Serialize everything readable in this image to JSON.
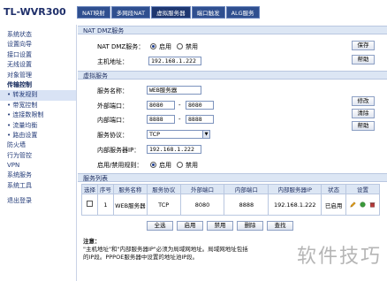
{
  "brand": "TL-WVR300",
  "tabs": [
    {
      "label": "NAT映射",
      "active": false
    },
    {
      "label": "多网段NAT",
      "active": false
    },
    {
      "label": "虚拟服务器",
      "active": true
    },
    {
      "label": "端口触发",
      "active": false
    },
    {
      "label": "ALG服务",
      "active": false
    }
  ],
  "sidebar": {
    "items": [
      {
        "label": "系统状态"
      },
      {
        "label": "设置向导"
      },
      {
        "label": "接口设置"
      },
      {
        "label": "无线设置"
      },
      {
        "label": "对象管理"
      },
      {
        "label": "传输控制"
      },
      {
        "label": "转发规则"
      },
      {
        "label": "带宽控制"
      },
      {
        "label": "连接数限制"
      },
      {
        "label": "流量均衡"
      },
      {
        "label": "路由设置"
      },
      {
        "label": "防火墙"
      },
      {
        "label": "行为管控"
      },
      {
        "label": "VPN"
      },
      {
        "label": "系统服务"
      },
      {
        "label": "系统工具"
      },
      {
        "label": "退出登录"
      }
    ]
  },
  "dmz": {
    "section_title": "NAT DMZ服务",
    "service_label": "NAT DMZ服务：",
    "enable_label": "启用",
    "disable_label": "禁用",
    "host_label": "主机地址：",
    "host_value": "192.168.1.222",
    "save_button": "保存",
    "help_button": "帮助"
  },
  "virtual": {
    "section_title": "虚拟服务",
    "name_label": "服务名称：",
    "name_value": "WEB服务器",
    "ext_port_label": "外部端口：",
    "ext_port_from": "8080",
    "ext_port_to": "8080",
    "int_port_label": "内部端口：",
    "int_port_from": "8888",
    "int_port_to": "8888",
    "protocol_label": "服务协议：",
    "protocol_value": "TCP",
    "server_ip_label": "内部服务器IP：",
    "server_ip_value": "192.168.1.222",
    "rule_label": "启用/禁用规则：",
    "enable_label": "启用",
    "disable_label": "禁用",
    "modify_button": "修改",
    "clear_button": "清除",
    "help_button": "帮助",
    "dash": "-"
  },
  "list": {
    "section_title": "服务列表",
    "headers": [
      "选择",
      "序号",
      "服务名称",
      "服务协议",
      "外部端口",
      "内部端口",
      "内部服务器IP",
      "状态",
      "设置"
    ],
    "rows": [
      {
        "index": "1",
        "name": "WEB服务器",
        "protocol": "TCP",
        "ext_port": "8080",
        "int_port": "8888",
        "ip": "192.168.1.222",
        "status": "已启用"
      }
    ],
    "buttons": [
      "全选",
      "启用",
      "禁用",
      "删除",
      "查找"
    ]
  },
  "note": {
    "title": "注意：",
    "line1": "\"主机地址\"和\"内部服务器IP\"必须为局域网地址。局域网地址包括",
    "line2": "的IP段。PPPOE服务器中设置的地址池IP段。"
  },
  "watermark": "软件技巧",
  "colors": {
    "tab_bg": "#2f4f8f",
    "section_bg": "#dce6f4",
    "menu_text": "#223a77"
  }
}
